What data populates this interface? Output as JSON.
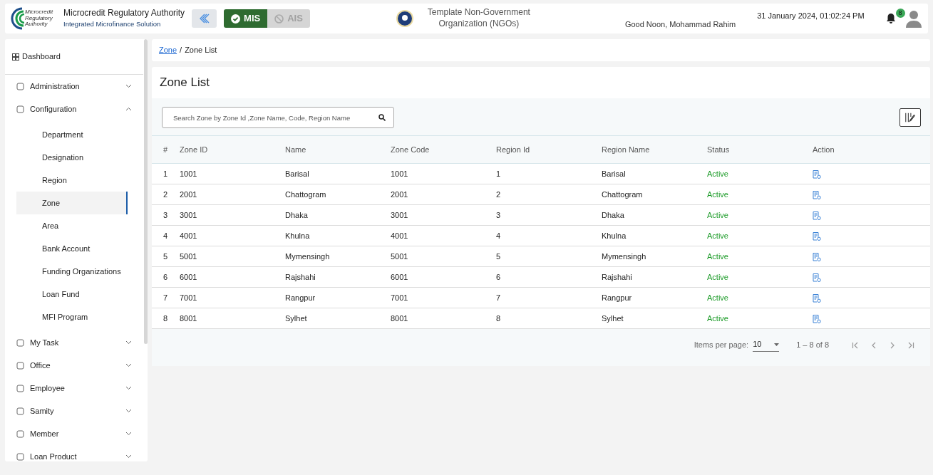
{
  "header": {
    "org_name": "Microcredit Regulatory Authority",
    "org_subtitle": "Integrated Microfinance Solution",
    "logo_text": "Microcredit Regulatory Authority",
    "modules": [
      {
        "label": "MIS",
        "selected": true
      },
      {
        "label": "AIS",
        "selected": false
      }
    ],
    "organization": "Template Non-Government Organization (NGOs)",
    "greeting": "Good Noon, Mohammad Rahim",
    "datetime": "31 January 2024, 01:02:24 PM",
    "notification_count": "8"
  },
  "sidebar": {
    "dashboard": "Dashboard",
    "items": [
      {
        "label": "Administration",
        "expanded": false
      },
      {
        "label": "Configuration",
        "expanded": true,
        "children": [
          {
            "label": "Department",
            "selected": false
          },
          {
            "label": "Designation",
            "selected": false
          },
          {
            "label": "Region",
            "selected": false
          },
          {
            "label": "Zone",
            "selected": true
          },
          {
            "label": "Area",
            "selected": false
          },
          {
            "label": "Bank Account",
            "selected": false
          },
          {
            "label": "Funding Organizations",
            "selected": false
          },
          {
            "label": "Loan Fund",
            "selected": false
          },
          {
            "label": "MFI Program",
            "selected": false
          }
        ]
      },
      {
        "label": "My Task",
        "expanded": false
      },
      {
        "label": "Office",
        "expanded": false
      },
      {
        "label": "Employee",
        "expanded": false
      },
      {
        "label": "Samity",
        "expanded": false
      },
      {
        "label": "Member",
        "expanded": false
      },
      {
        "label": "Loan Product",
        "expanded": false
      }
    ]
  },
  "breadcrumb": {
    "link": "Zone",
    "separator": "/",
    "current": "Zone List"
  },
  "page_title": "Zone List",
  "search": {
    "placeholder": "Search Zone by Zone Id ,Zone Name, Code, Region Name"
  },
  "table": {
    "columns": [
      "#",
      "Zone ID",
      "Name",
      "Zone Code",
      "Region Id",
      "Region Name",
      "Status",
      "Action"
    ],
    "rows": [
      [
        "1",
        "1001",
        "Barisal",
        "1001",
        "1",
        "Barisal",
        "Active"
      ],
      [
        "2",
        "2001",
        "Chattogram",
        "2001",
        "2",
        "Chattogram",
        "Active"
      ],
      [
        "3",
        "3001",
        "Dhaka",
        "3001",
        "3",
        "Dhaka",
        "Active"
      ],
      [
        "4",
        "4001",
        "Khulna",
        "4001",
        "4",
        "Khulna",
        "Active"
      ],
      [
        "5",
        "5001",
        "Mymensingh",
        "5001",
        "5",
        "Mymensingh",
        "Active"
      ],
      [
        "6",
        "6001",
        "Rajshahi",
        "6001",
        "6",
        "Rajshahi",
        "Active"
      ],
      [
        "7",
        "7001",
        "Rangpur",
        "7001",
        "7",
        "Rangpur",
        "Active"
      ],
      [
        "8",
        "8001",
        "Sylhet",
        "8001",
        "8",
        "Sylhet",
        "Active"
      ]
    ]
  },
  "pagination": {
    "label": "Items per page:",
    "page_size": "10",
    "range": "1 – 8 of 8"
  }
}
